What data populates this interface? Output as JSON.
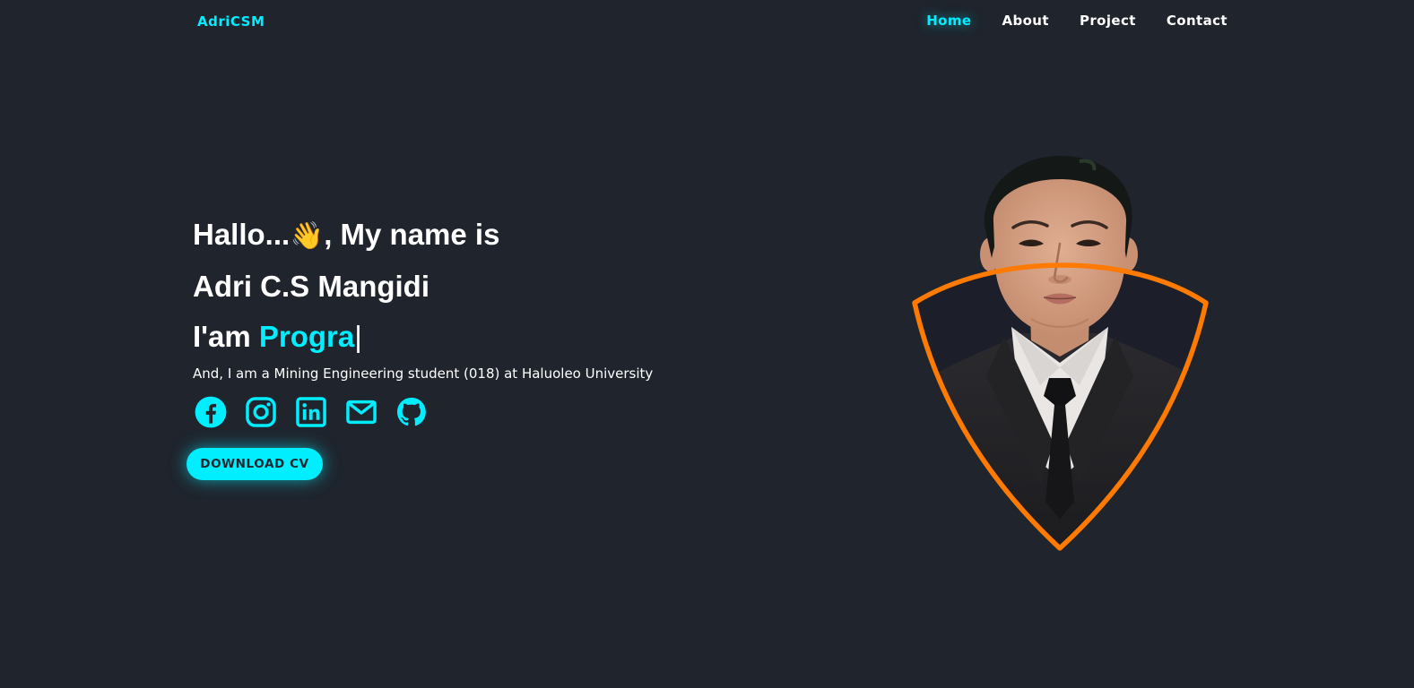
{
  "header": {
    "logo": "AdriCSM",
    "nav": [
      "Home",
      "About",
      "Project",
      "Contact"
    ],
    "active": "Home"
  },
  "hero": {
    "greeting_before": "Hallo...",
    "wave_emoji": "👋",
    "greeting_after": ", My name is",
    "name": "Adri C.S Mangidi",
    "role_prefix": "I'am ",
    "role_typed": "Progra",
    "caret": "|",
    "description": "And, I am a Mining Engineering student (018) at Haluoleo University"
  },
  "socials": [
    "facebook-icon",
    "instagram-icon",
    "linkedin-icon",
    "mail-icon",
    "github-icon"
  ],
  "cta": {
    "label": "DOWNLOAD CV"
  },
  "colors": {
    "background": "#1f242d",
    "accent": "#00eeff",
    "frame": "#ff7a00"
  }
}
